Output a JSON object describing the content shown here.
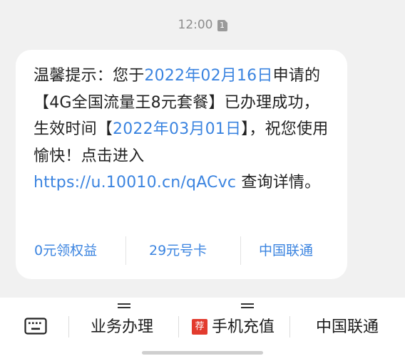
{
  "header": {
    "time": "12:00",
    "sim_label": "1"
  },
  "message": {
    "segments": [
      {
        "text": "温馨提示：您于",
        "color": "default"
      },
      {
        "text": "2022年02月16日",
        "color": "blue"
      },
      {
        "text": "申请的【4G全国流量王8元套餐】已办理成功，生效时间【",
        "color": "default"
      },
      {
        "text": "2022年03月01日",
        "color": "blue"
      },
      {
        "text": "】，祝您使用愉快！点击进入",
        "color": "default"
      },
      {
        "text": "https://u.10010.cn/qACvc",
        "color": "link"
      },
      {
        "text": " 查询详情。",
        "color": "default"
      }
    ]
  },
  "quick_replies": [
    {
      "label": "0元领权益"
    },
    {
      "label": "29元号卡"
    },
    {
      "label": "中国联通"
    }
  ],
  "menu_bar": {
    "keyboard_icon": "keyboard-icon",
    "items": [
      {
        "label": "业务办理"
      },
      {
        "label": "手机充值",
        "badge": "荐"
      },
      {
        "label": "中国联通"
      }
    ]
  },
  "colors": {
    "accent": "#3b84e0",
    "background": "#f1f1f1",
    "badge": "#e23b2e"
  }
}
